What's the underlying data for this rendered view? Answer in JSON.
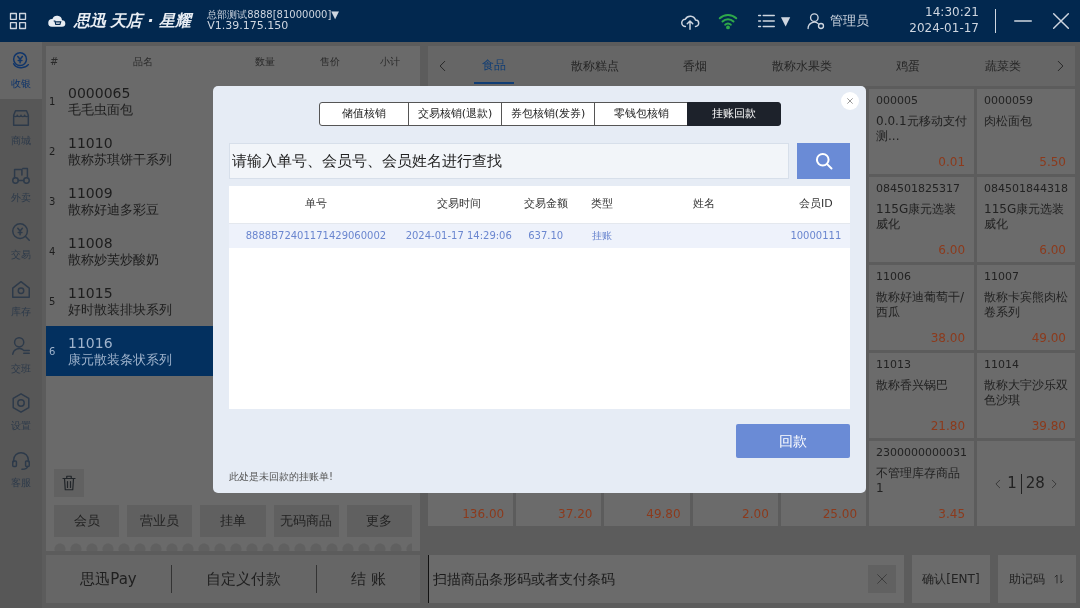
{
  "top_bar": {
    "logo_brand": "思迅",
    "logo_product": "天店 · 星耀",
    "store": "总部测试8888[81000000]▼",
    "version": "V1.39.175.150",
    "menu_caret": "▼",
    "user": "管理员",
    "time": "14:30:21",
    "date": "2024-01-17"
  },
  "sidebar": {
    "items": [
      {
        "label": "收银",
        "kind": "cashier",
        "selected": true
      },
      {
        "label": "商城",
        "kind": "shop",
        "selected": false
      },
      {
        "label": "外卖",
        "kind": "delivery",
        "selected": false
      },
      {
        "label": "交易",
        "kind": "trade",
        "selected": false
      },
      {
        "label": "库存",
        "kind": "stock",
        "selected": false
      },
      {
        "label": "交班",
        "kind": "shift",
        "selected": false
      },
      {
        "label": "设置",
        "kind": "settings",
        "selected": false
      },
      {
        "label": "客服",
        "kind": "support",
        "selected": false
      }
    ]
  },
  "cart": {
    "columns": [
      "#",
      "品名",
      "数量",
      "售价",
      "小计"
    ],
    "rows": [
      {
        "index": "1",
        "code": "0000065",
        "name": "毛毛虫面包",
        "selected": false
      },
      {
        "index": "2",
        "code": "11010",
        "name": "散称苏琪饼干系列",
        "selected": false
      },
      {
        "index": "3",
        "code": "11009",
        "name": "散称好迪多彩豆",
        "selected": false
      },
      {
        "index": "4",
        "code": "11008",
        "name": "散称妙芙炒酸奶",
        "selected": false
      },
      {
        "index": "5",
        "code": "11015",
        "name": "好时散装排块系列",
        "selected": false
      },
      {
        "index": "6",
        "code": "11016",
        "name": "康元散装条状系列",
        "selected": true
      }
    ],
    "actions": [
      "会员",
      "营业员",
      "挂单",
      "无码商品",
      "更多"
    ]
  },
  "categories": [
    {
      "label": "食品",
      "selected": true
    },
    {
      "label": "散称糕点",
      "selected": false
    },
    {
      "label": "香烟",
      "selected": false
    },
    {
      "label": "散称水果类",
      "selected": false
    },
    {
      "label": "鸡蛋",
      "selected": false
    },
    {
      "label": "蔬菜类",
      "selected": false
    }
  ],
  "products": {
    "rows": [
      [
        {
          "code": "000005",
          "name": "0.0.1元移动支付测...",
          "price": "0.01"
        },
        {
          "code": "0000059",
          "name": "肉松面包",
          "price": "5.50"
        }
      ],
      [
        {
          "code": "084501825317",
          "name": "115G康元选装威化",
          "price": "6.00"
        },
        {
          "code": "084501844318",
          "name": "115G康元选装威化",
          "price": "6.00"
        }
      ],
      [
        {
          "code": "11006",
          "name": "散称好迪葡萄干/西瓜",
          "price": "38.00"
        },
        {
          "code": "11007",
          "name": "散称卡宾熊肉松卷系列",
          "price": "49.00"
        }
      ],
      [
        {
          "code": "11013",
          "name": "散称香兴锅巴",
          "price": "21.80"
        },
        {
          "code": "11014",
          "name": "散称大宇沙乐双色沙琪",
          "price": "39.80"
        }
      ],
      [
        {
          "price": "136.00"
        },
        {
          "price": "37.20"
        },
        {
          "price": "49.80"
        },
        {
          "price": "2.00"
        },
        {
          "price": "25.00"
        },
        {
          "code": "2300000000031",
          "name": "不管理库存商品1",
          "price": "3.45"
        }
      ]
    ],
    "pager": {
      "page": "1",
      "total": "28"
    }
  },
  "payment": [
    "思迅Pay",
    "自定义付款",
    "结 账"
  ],
  "scan": {
    "placeholder": "扫描商品条形码或者支付条码"
  },
  "confirm_button": "确认[ENT]",
  "mnemonic_button": "助记码",
  "dialog": {
    "tabs": [
      {
        "label": "储值核销",
        "selected": false
      },
      {
        "label": "交易核销(退款)",
        "selected": false
      },
      {
        "label": "券包核销(发券)",
        "selected": false
      },
      {
        "label": "零钱包核销",
        "selected": false
      },
      {
        "label": "挂账回款",
        "selected": true
      }
    ],
    "search": {
      "placeholder": "请输入单号、会员号、会员姓名进行查找"
    },
    "table": {
      "columns": [
        "单号",
        "交易时间",
        "交易金额",
        "类型",
        "姓名",
        "会员ID"
      ],
      "rows": [
        {
          "cells": [
            "8888B72401171429060002",
            "2024-01-17 14:29:06",
            "637.10",
            "挂账",
            "",
            "10000111"
          ],
          "selected": true
        }
      ]
    },
    "note": "此处是未回款的挂账单!",
    "button": "回款"
  }
}
